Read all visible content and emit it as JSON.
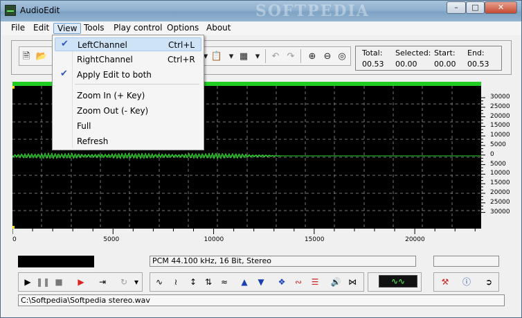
{
  "window": {
    "title": "AudioEdit",
    "watermark": "SOFTPEDIA"
  },
  "menubar": {
    "items": [
      "File",
      "Edit",
      "View",
      "Tools",
      "Play control",
      "Options",
      "About"
    ]
  },
  "view_menu": {
    "items": [
      {
        "label": "LeftChannel",
        "shortcut": "Ctrl+L",
        "checked": true
      },
      {
        "label": "RightChannel",
        "shortcut": "Ctrl+R",
        "checked": false
      },
      {
        "label": "Apply Edit to both",
        "shortcut": "",
        "checked": true
      },
      {
        "label": "Zoom In (+ Key)",
        "shortcut": "",
        "checked": false
      },
      {
        "label": "Zoom Out  (- Key)",
        "shortcut": "",
        "checked": false
      },
      {
        "label": "Full",
        "shortcut": "",
        "checked": false
      },
      {
        "label": "Refresh",
        "shortcut": "",
        "checked": false
      }
    ]
  },
  "info": {
    "total_label": "Total:",
    "total_value": "00.53",
    "selected_label": "Selected:",
    "selected_value": "00.00",
    "start_label": "Start:",
    "start_value": "00.00",
    "end_label": "End:",
    "end_value": "00.53"
  },
  "waveform": {
    "y_ticks": [
      "30000",
      "25000",
      "20000",
      "15000",
      "10000",
      "5000",
      "0",
      "5000",
      "10000",
      "15000",
      "20000",
      "25000",
      "30000"
    ],
    "x_ticks": [
      "0",
      "5000",
      "10000",
      "15000",
      "20000"
    ],
    "signal_end_sample": 13500,
    "x_max": 23300,
    "wave_color": "#33dd33",
    "grid_color": "#777777"
  },
  "status": {
    "format": "PCM 44.100 kHz, 16 Bit, Stereo"
  },
  "file_path": "C:\\Softpedia\\Softpedia stereo.wav",
  "colors": {
    "accent_green": "#22cc22",
    "background": "#000000"
  }
}
